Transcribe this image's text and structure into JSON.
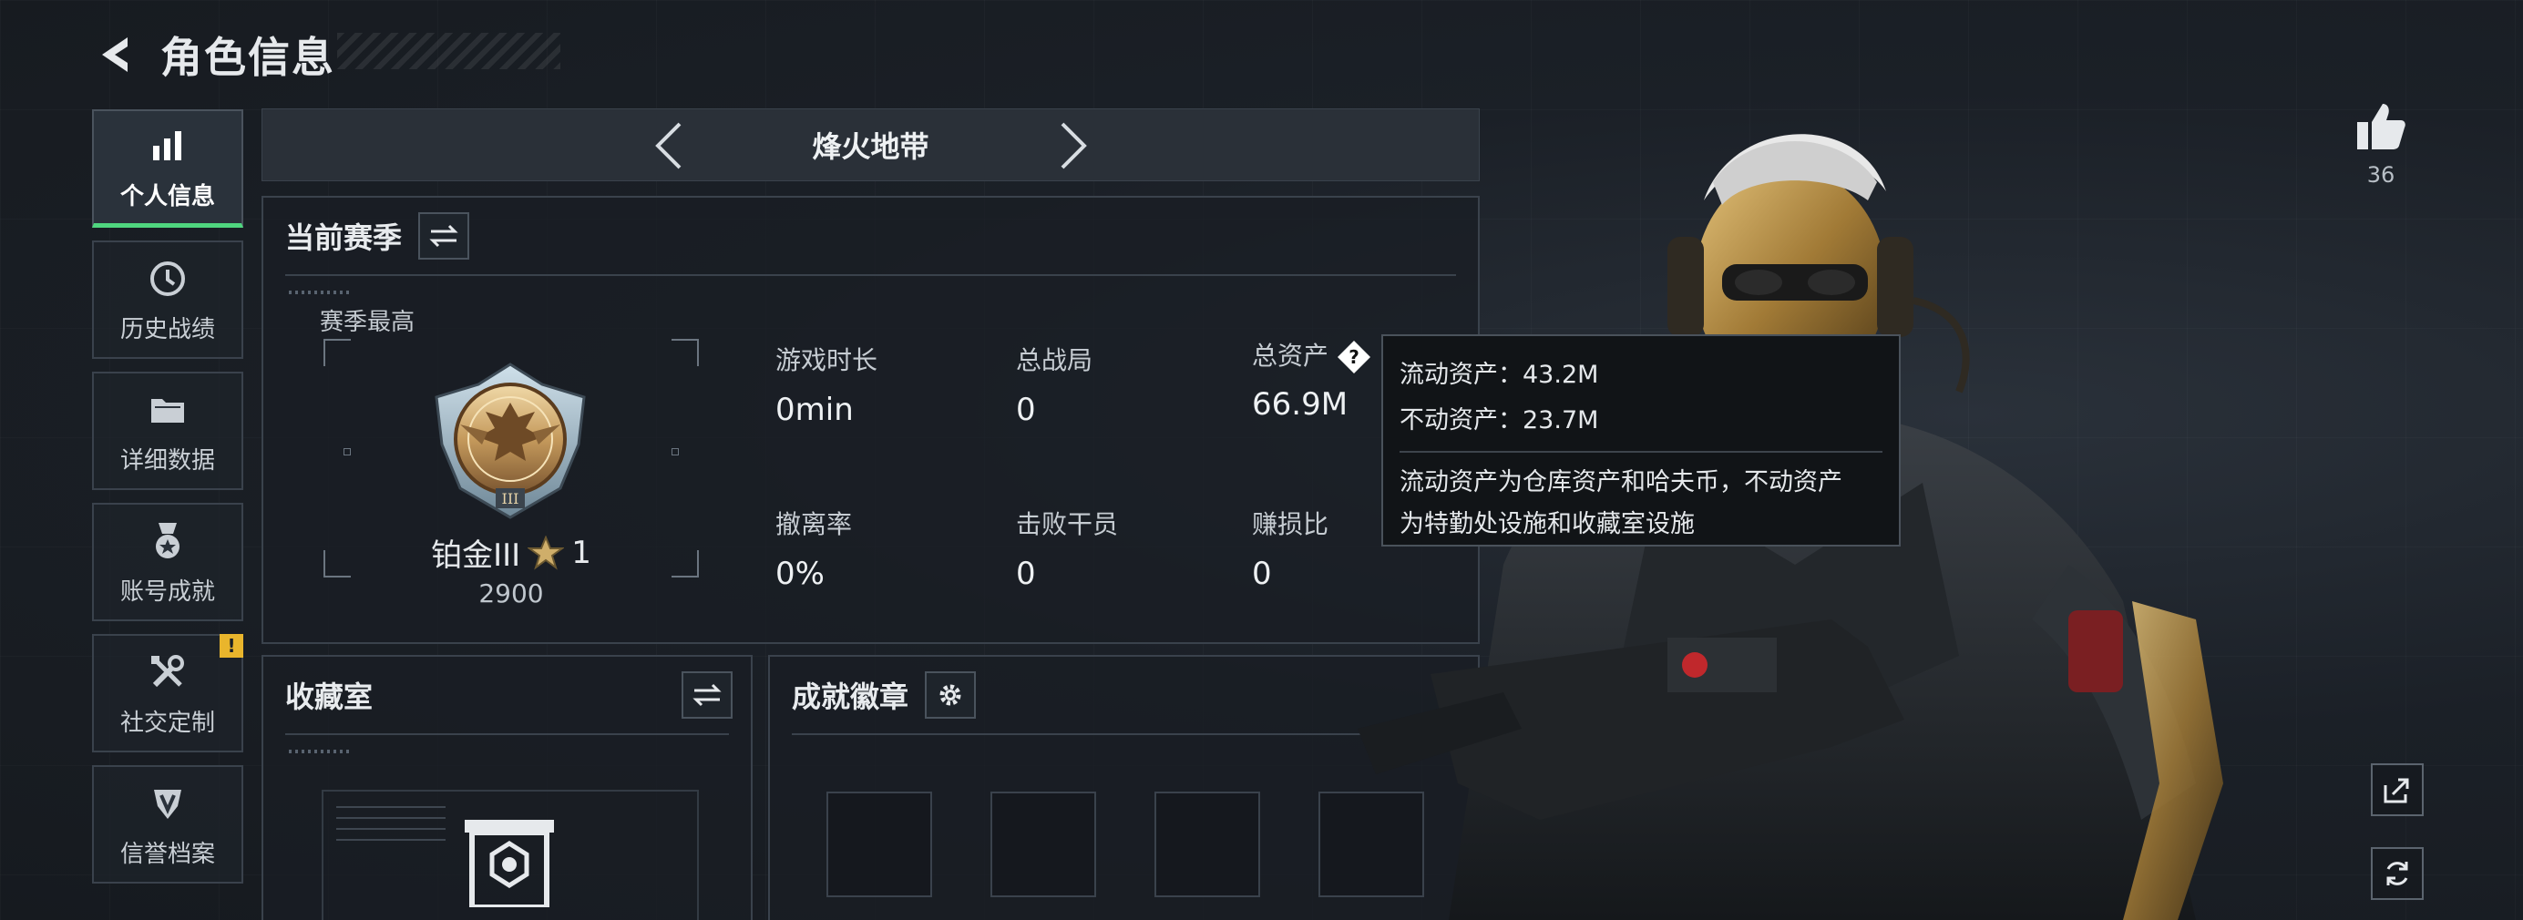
{
  "header": {
    "title": "角色信息"
  },
  "sidebar": {
    "items": [
      {
        "label": "个人信息",
        "icon": "bar-chart-icon",
        "active": true
      },
      {
        "label": "历史战绩",
        "icon": "history-icon"
      },
      {
        "label": "详细数据",
        "icon": "folder-icon"
      },
      {
        "label": "账号成就",
        "icon": "medal-icon"
      },
      {
        "label": "社交定制",
        "icon": "tools-icon",
        "badge": "!"
      },
      {
        "label": "信誉档案",
        "icon": "shield-icon"
      }
    ]
  },
  "mode": {
    "title": "烽火地带"
  },
  "season": {
    "title": "当前赛季",
    "best_label": "赛季最高",
    "rank_name": "铂金III",
    "rank_stars": "1",
    "rank_points": "2900",
    "stats": [
      {
        "label": "游戏时长",
        "value": "0min"
      },
      {
        "label": "总战局",
        "value": "0"
      },
      {
        "label": "总资产",
        "value": "66.9M"
      },
      {
        "label": "撤离率",
        "value": "0%"
      },
      {
        "label": "击败干员",
        "value": "0"
      },
      {
        "label": "赚损比",
        "value": "0"
      }
    ]
  },
  "tooltip": {
    "liquid": "流动资产：43.2M",
    "fixed": "不动资产：23.7M",
    "note_line1": "流动资产为仓库资产和哈夫币，不动资产",
    "note_line2": "为特勤处设施和收藏室设施"
  },
  "collection": {
    "title": "收藏室"
  },
  "badges": {
    "title": "成就徽章"
  },
  "likes": {
    "count": "36"
  },
  "colors": {
    "accent_green": "#4fd67f",
    "warning": "#e9b52c",
    "panel_border": "#3a424c"
  }
}
